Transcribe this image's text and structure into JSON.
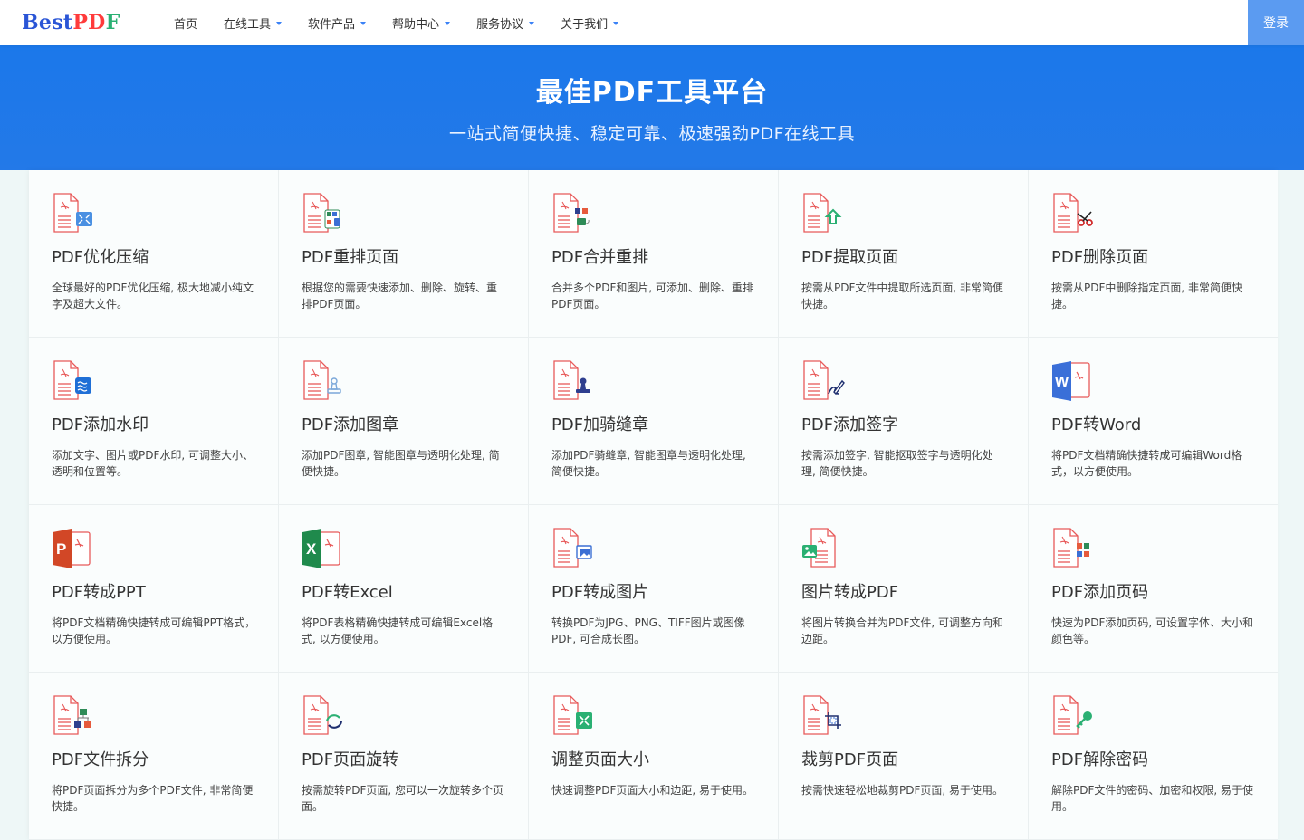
{
  "header": {
    "logo": {
      "part1": "Best",
      "part2": "PD",
      "part3": "F"
    },
    "nav": [
      {
        "label": "首页",
        "dropdown": false
      },
      {
        "label": "在线工具",
        "dropdown": true
      },
      {
        "label": "软件产品",
        "dropdown": true
      },
      {
        "label": "帮助中心",
        "dropdown": true
      },
      {
        "label": "服务协议",
        "dropdown": true
      },
      {
        "label": "关于我们",
        "dropdown": true
      }
    ],
    "login_label": "登录"
  },
  "hero": {
    "title": "最佳PDF工具平台",
    "subtitle": "一站式简便快捷、稳定可靠、极速强劲PDF在线工具"
  },
  "colors": {
    "brand_blue": "#1b78ea",
    "login_bg": "#5b9bf1",
    "pdf_red": "#e85a5a"
  },
  "tools": [
    {
      "icon": "compress-icon",
      "title": "PDF优化压缩",
      "desc": "全球最好的PDF优化压缩, 极大地减小纯文字及超大文件。"
    },
    {
      "icon": "reorder-icon",
      "title": "PDF重排页面",
      "desc": "根据您的需要快速添加、删除、旋转、重排PDF页面。"
    },
    {
      "icon": "merge-icon",
      "title": "PDF合并重排",
      "desc": "合并多个PDF和图片, 可添加、删除、重排PDF页面。"
    },
    {
      "icon": "extract-icon",
      "title": "PDF提取页面",
      "desc": "按需从PDF文件中提取所选页面, 非常简便快捷。"
    },
    {
      "icon": "scissors-icon",
      "title": "PDF删除页面",
      "desc": "按需从PDF中删除指定页面, 非常简便快捷。"
    },
    {
      "icon": "watermark-icon",
      "title": "PDF添加水印",
      "desc": "添加文字、图片或PDF水印, 可调整大小、透明和位置等。"
    },
    {
      "icon": "stamp-icon",
      "title": "PDF添加图章",
      "desc": "添加PDF图章, 智能图章与透明化处理, 简便快捷。"
    },
    {
      "icon": "seal-icon",
      "title": "PDF加骑缝章",
      "desc": "添加PDF骑缝章, 智能图章与透明化处理, 简便快捷。"
    },
    {
      "icon": "signature-icon",
      "title": "PDF添加签字",
      "desc": "按需添加签字, 智能抠取签字与透明化处理, 简便快捷。"
    },
    {
      "icon": "word-icon",
      "title": "PDF转Word",
      "desc": "将PDF文档精确快捷转成可编辑Word格式，以方便使用。"
    },
    {
      "icon": "ppt-icon",
      "title": "PDF转成PPT",
      "desc": "将PDF文档精确快捷转成可编辑PPT格式，以方便使用。"
    },
    {
      "icon": "excel-icon",
      "title": "PDF转Excel",
      "desc": "将PDF表格精确快捷转成可编辑Excel格式, 以方便使用。"
    },
    {
      "icon": "pdf-to-image-icon",
      "title": "PDF转成图片",
      "desc": "转换PDF为JPG、PNG、TIFF图片或图像PDF, 可合成长图。"
    },
    {
      "icon": "image-to-pdf-icon",
      "title": "图片转成PDF",
      "desc": "将图片转换合并为PDF文件, 可调整方向和边距。"
    },
    {
      "icon": "page-number-icon",
      "title": "PDF添加页码",
      "desc": "快速为PDF添加页码, 可设置字体、大小和颜色等。"
    },
    {
      "icon": "split-icon",
      "title": "PDF文件拆分",
      "desc": "将PDF页面拆分为多个PDF文件, 非常简便快捷。"
    },
    {
      "icon": "rotate-icon",
      "title": "PDF页面旋转",
      "desc": "按需旋转PDF页面, 您可以一次旋转多个页面。"
    },
    {
      "icon": "resize-icon",
      "title": "调整页面大小",
      "desc": "快速调整PDF页面大小和边距, 易于使用。"
    },
    {
      "icon": "crop-icon",
      "title": "裁剪PDF页面",
      "desc": "按需快速轻松地裁剪PDF页面, 易于使用。"
    },
    {
      "icon": "unlock-icon",
      "title": "PDF解除密码",
      "desc": "解除PDF文件的密码、加密和权限, 易于使用。"
    }
  ]
}
